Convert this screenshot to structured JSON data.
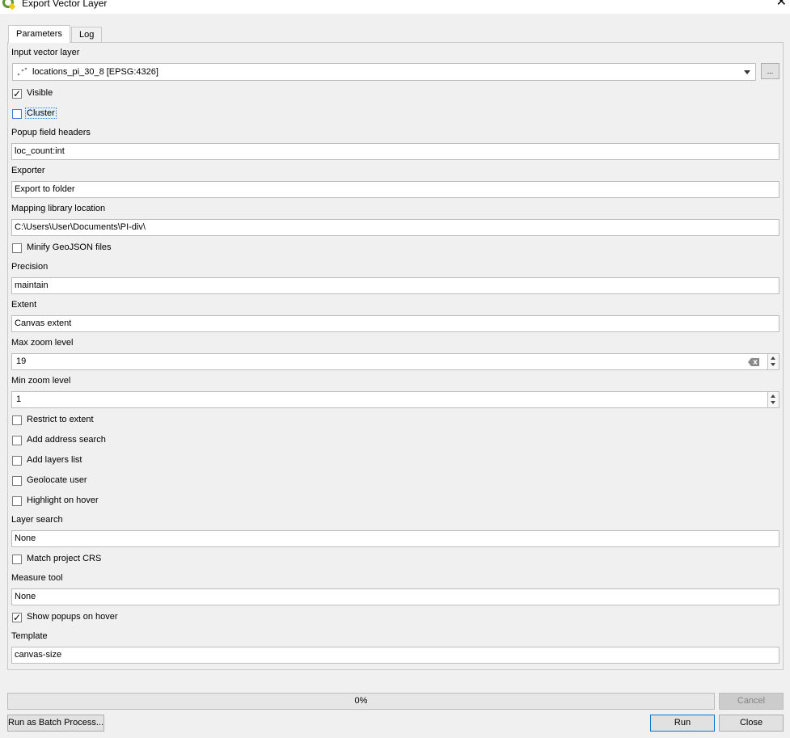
{
  "window": {
    "title": "Export Vector Layer",
    "close_glyph": "✕",
    "logo_icon": "qgis-logo-icon"
  },
  "tabs": [
    {
      "label": "Parameters",
      "active": true
    },
    {
      "label": "Log",
      "active": false
    }
  ],
  "form": {
    "input_layer": {
      "label": "Input vector layer",
      "value": "locations_pi_30_8 [EPSG:4326]",
      "browse_label": "..."
    },
    "visible": {
      "label": "Visible",
      "checked": true
    },
    "cluster": {
      "label": "Cluster",
      "checked": false
    },
    "popup_headers": {
      "label": "Popup field headers",
      "value": "loc_count:int"
    },
    "exporter": {
      "label": "Exporter",
      "value": "Export to folder"
    },
    "mapping_library": {
      "label": "Mapping library location",
      "value": "C:\\Users\\User\\Documents\\PI-div\\"
    },
    "minify": {
      "label": "Minify GeoJSON files",
      "checked": false
    },
    "precision": {
      "label": "Precision",
      "value": "maintain"
    },
    "extent": {
      "label": "Extent",
      "value": "Canvas extent"
    },
    "max_zoom": {
      "label": "Max zoom level",
      "value": "19"
    },
    "min_zoom": {
      "label": "Min zoom level",
      "value": "1"
    },
    "restrict_extent": {
      "label": "Restrict to extent",
      "checked": false
    },
    "address_search": {
      "label": "Add address search",
      "checked": false
    },
    "layers_list": {
      "label": "Add layers list",
      "checked": false
    },
    "geolocate": {
      "label": "Geolocate user",
      "checked": false
    },
    "highlight": {
      "label": "Highlight on hover",
      "checked": false
    },
    "layer_search": {
      "label": "Layer search",
      "value": "None"
    },
    "match_crs": {
      "label": "Match project CRS",
      "checked": false
    },
    "measure_tool": {
      "label": "Measure tool",
      "value": "None"
    },
    "show_popups": {
      "label": "Show popups on hover",
      "checked": true
    },
    "template": {
      "label": "Template",
      "value": "canvas-size"
    }
  },
  "footer": {
    "progress_text": "0%",
    "progress": 0,
    "cancel_label": "Cancel",
    "batch_label": "Run as Batch Process...",
    "run_label": "Run",
    "close_label": "Close"
  },
  "colors": {
    "accent": "#0078d7",
    "background": "#f0f0f0",
    "qgis_green": "#589632",
    "qgis_yellow": "#eec90d"
  }
}
